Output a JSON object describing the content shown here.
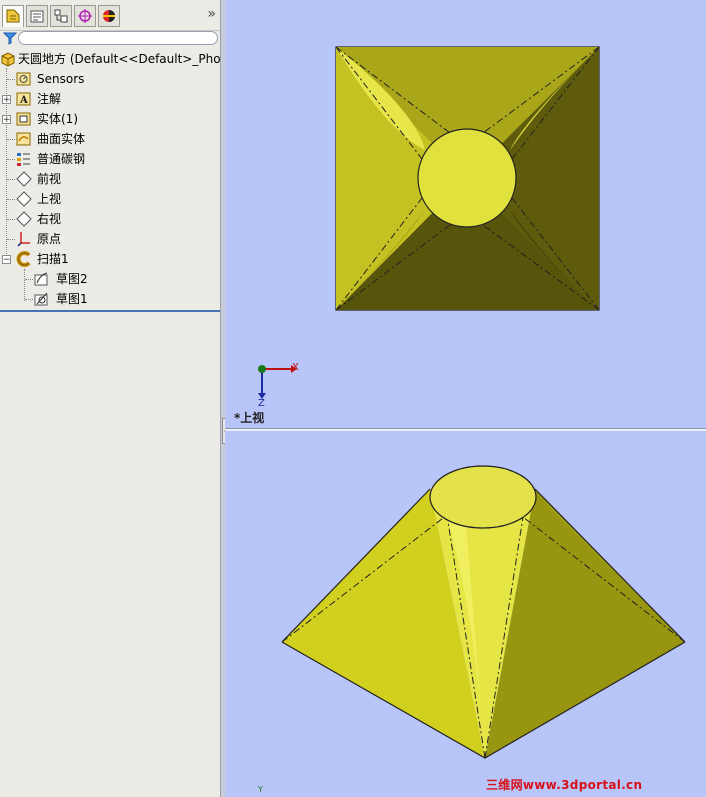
{
  "tree": {
    "root_label": "天圆地方  (Default<<Default>_Photo",
    "items": [
      {
        "label": "Sensors",
        "icon": "sensor-icon"
      },
      {
        "label": "注解",
        "icon": "annotation-icon"
      },
      {
        "label": "实体(1)",
        "icon": "solid-body-icon"
      },
      {
        "label": "曲面实体",
        "icon": "surface-body-icon"
      },
      {
        "label": "普通碳钢",
        "icon": "material-icon"
      },
      {
        "label": "前视",
        "icon": "plane-icon"
      },
      {
        "label": "上视",
        "icon": "plane-icon"
      },
      {
        "label": "右视",
        "icon": "plane-icon"
      },
      {
        "label": "原点",
        "icon": "origin-icon"
      },
      {
        "label": "扫描1",
        "icon": "sweep-icon"
      },
      {
        "label": "草图2",
        "icon": "sketch-icon"
      },
      {
        "label": "草图1",
        "icon": "sketch-icon"
      }
    ]
  },
  "toolbar": {
    "more_label": "»"
  },
  "viewport": {
    "view_label": "*上视",
    "triad_x": "X",
    "triad_z": "Z",
    "triad_y_bottom": "Y"
  },
  "watermark": "三维网www.3dportal.cn",
  "colors": {
    "model_light": "#e8e84a",
    "model_mid": "#c6c41d",
    "model_dark": "#6f6c10",
    "background": "#b8c5f8"
  }
}
